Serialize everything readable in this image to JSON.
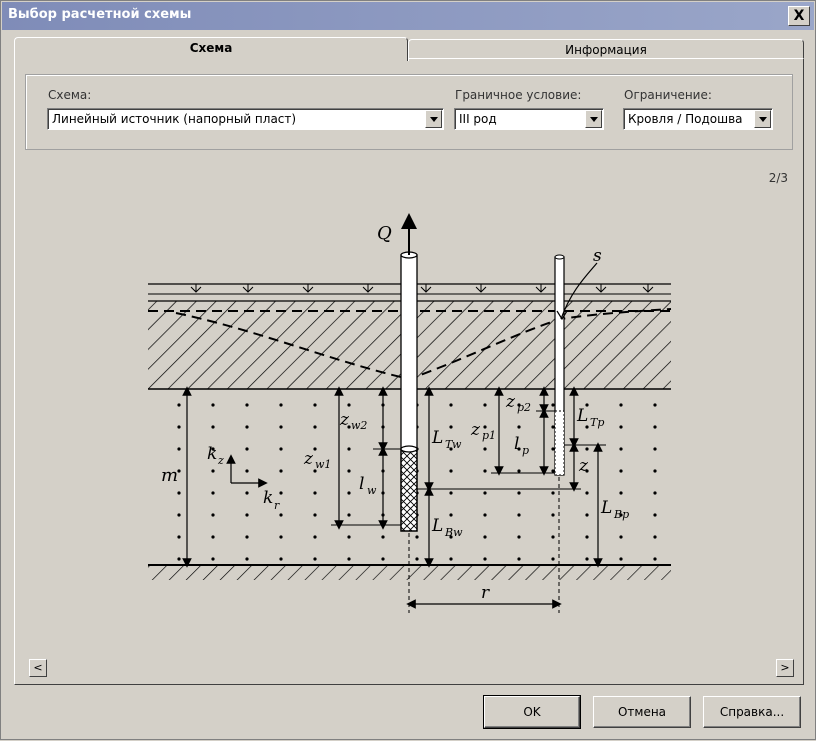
{
  "window": {
    "title": "Выбор расчетной схемы",
    "close_label": "X"
  },
  "tabs": [
    {
      "label": "Схема",
      "active": true
    },
    {
      "label": "Информация",
      "active": false
    }
  ],
  "form": {
    "scheme_label": "Схема:",
    "scheme_value": "Линейный источник (напорный пласт)",
    "boundary_label": "Граничное условие:",
    "boundary_value": "III род",
    "limit_label": "Ограничение:",
    "limit_value": "Кровля / Подошва"
  },
  "pager": {
    "text": "2/3"
  },
  "scroll": {
    "left": "<",
    "right": ">"
  },
  "diagram": {
    "Q": "Q",
    "s": "s",
    "m": "m",
    "kz": "k",
    "kz_sub": "z",
    "kr": "k",
    "kr_sub": "r",
    "r": "r",
    "z": "z",
    "zw2": "z",
    "zw2_sub": "w2",
    "zw1": "z",
    "zw1_sub": "w1",
    "lw": "l",
    "lw_sub": "w",
    "LTw": "L",
    "LTw_sub": "Tw",
    "LBw": "L",
    "LBw_sub": "Bw",
    "zp2": "z",
    "zp2_sub": "p2",
    "zp1": "z",
    "zp1_sub": "p1",
    "lp": "l",
    "lp_sub": "p",
    "LTp": "L",
    "LTp_sub": "Tp",
    "LBp": "L",
    "LBp_sub": "Bp"
  },
  "buttons": {
    "ok": "OK",
    "cancel": "Отмена",
    "help": "Справка..."
  }
}
